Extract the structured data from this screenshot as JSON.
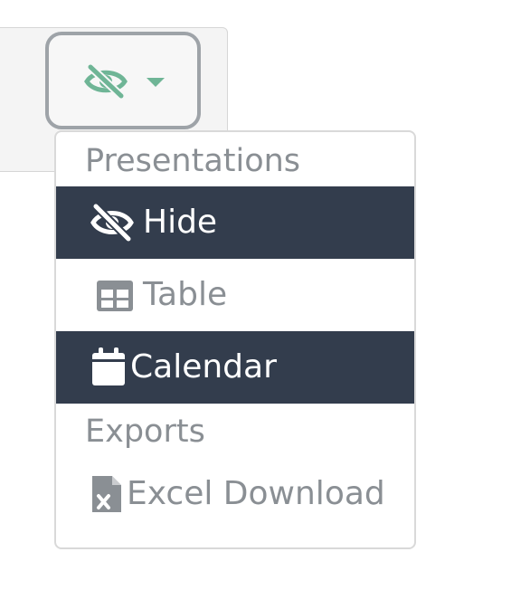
{
  "toolbar": {
    "toggle_button": {
      "icon": "eye-slash-icon",
      "caret_icon": "caret-down-icon",
      "color": "#6fb596"
    }
  },
  "menu": {
    "sections": [
      {
        "header": "Presentations",
        "items": [
          {
            "label": "Hide",
            "icon": "eye-slash-icon",
            "active": true
          },
          {
            "label": "Table",
            "icon": "table-icon",
            "active": false
          },
          {
            "label": "Calendar",
            "icon": "calendar-icon",
            "active": true
          }
        ]
      },
      {
        "header": "Exports",
        "items": [
          {
            "label": "Excel Download",
            "icon": "file-excel-icon",
            "active": false
          }
        ]
      }
    ],
    "colors": {
      "active_bg": "#333d4d",
      "active_text": "#ffffff",
      "muted_text": "#8a8f94"
    }
  }
}
